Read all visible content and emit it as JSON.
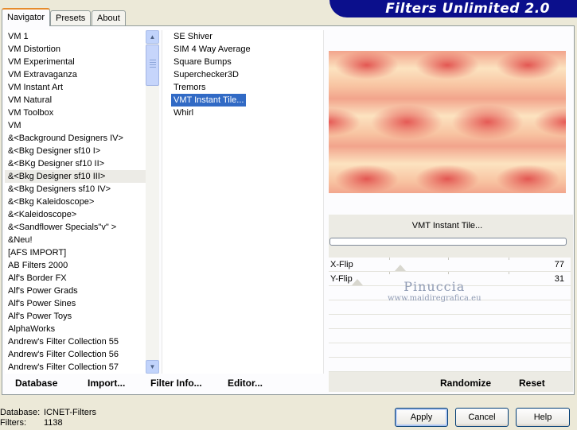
{
  "tabs": [
    "Navigator",
    "Presets",
    "About"
  ],
  "app_title": "Filters Unlimited 2.0",
  "categories": [
    "VM 1",
    "VM Distortion",
    "VM Experimental",
    "VM Extravaganza",
    "VM Instant Art",
    "VM Natural",
    "VM Toolbox",
    "VM",
    "&<Background Designers IV>",
    "&<Bkg Designer sf10 I>",
    "&<BKg Designer sf10 II>",
    "&<Bkg Designer sf10 III>",
    "&<Bkg Designers sf10 IV>",
    "&<Bkg Kaleidoscope>",
    "&<Kaleidoscope>",
    "&<Sandflower Specials\"v\" >",
    "&Neu!",
    "[AFS IMPORT]",
    "AB Filters 2000",
    "Alf's Border FX",
    "Alf's Power Grads",
    "Alf's Power Sines",
    "Alf's Power Toys",
    "AlphaWorks",
    "Andrew's Filter Collection 55",
    "Andrew's Filter Collection 56",
    "Andrew's Filter Collection 57"
  ],
  "selected_category_index": 11,
  "filters": [
    "SE Shiver",
    "SIM 4 Way Average",
    "Square Bumps",
    "Superchecker3D",
    "Tremors",
    "VMT Instant Tile...",
    "Whirl"
  ],
  "selected_filter_index": 5,
  "preview": {
    "filter_name": "VMT Instant Tile..."
  },
  "params": [
    {
      "label": "X-Flip",
      "value": "77",
      "level": 0.3
    },
    {
      "label": "Y-Flip",
      "value": "31",
      "level": 0.12
    }
  ],
  "watermark": {
    "name": "Pinuccia",
    "url": "www.maidiregrafica.eu"
  },
  "panel_buttons": {
    "database": "Database",
    "import": "Import...",
    "filter_info": "Filter Info...",
    "editor": "Editor...",
    "randomize": "Randomize",
    "reset": "Reset"
  },
  "footer": {
    "database_label": "Database:",
    "database_value": "ICNET-Filters",
    "filters_label": "Filters:",
    "filters_value": "1138"
  },
  "dialog_buttons": {
    "apply": "Apply",
    "cancel": "Cancel",
    "help": "Help"
  },
  "colors": {
    "banner": "#0b0f8c",
    "selection": "#316ac5",
    "active_tab_accent": "#e68b2c"
  }
}
